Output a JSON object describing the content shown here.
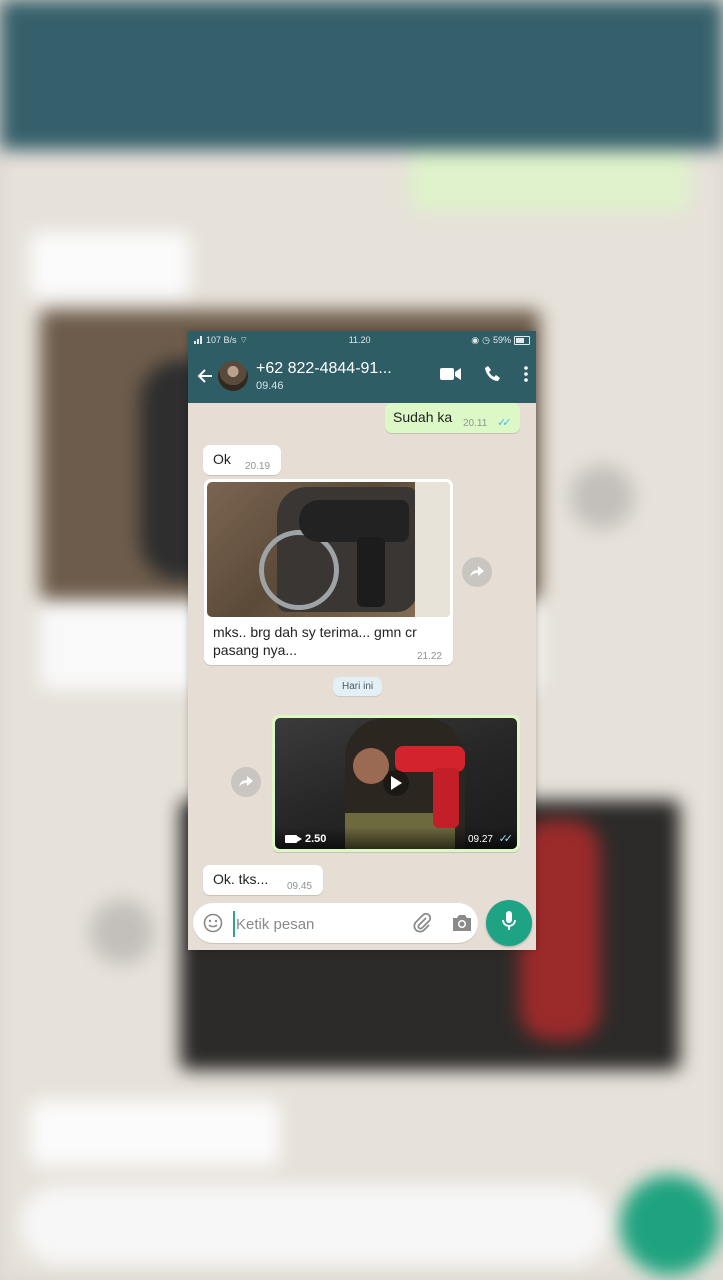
{
  "statusbar": {
    "net_speed": "107 B/s",
    "time": "11.20",
    "battery": "59%"
  },
  "header": {
    "contact_name": "+62 822-4844-91...",
    "last_seen": "09.46",
    "icons": [
      "back-arrow-icon",
      "video-call-icon",
      "voice-call-icon",
      "more-options-icon"
    ]
  },
  "messages": {
    "m1": {
      "text": "Sudah ka",
      "time": "20.11",
      "ticks": "✓✓"
    },
    "m2": {
      "text": "Ok",
      "time": "20.19"
    },
    "m3": {
      "caption": "mks.. brg dah sy terima... gmn cr pasang nya...",
      "time": "21.22"
    },
    "day_chip": "Hari ini",
    "m4": {
      "duration": "2.50",
      "time": "09.27",
      "ticks": "✓✓"
    },
    "m5": {
      "text": "Ok. tks...",
      "time": "09.45"
    }
  },
  "composer": {
    "placeholder": "Ketik pesan"
  },
  "colors": {
    "header": "#2f5d66",
    "outgoing_bubble": "#dcf8c6",
    "incoming_bubble": "#ffffff",
    "chat_background": "#e6ddd4",
    "accent_green": "#1fa385",
    "read_ticks": "#4fb6ec"
  }
}
